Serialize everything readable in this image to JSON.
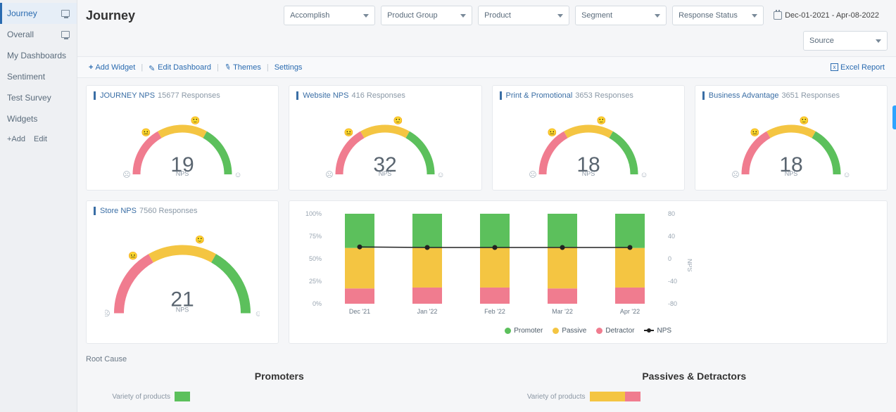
{
  "sidebar": {
    "items": [
      {
        "label": "Journey",
        "active": true,
        "hasMonitor": true
      },
      {
        "label": "Overall",
        "active": false,
        "hasMonitor": true
      },
      {
        "label": "My Dashboards",
        "active": false,
        "hasMonitor": false
      },
      {
        "label": "Sentiment",
        "active": false,
        "hasMonitor": false
      },
      {
        "label": "Test Survey",
        "active": false,
        "hasMonitor": false
      },
      {
        "label": "Widgets",
        "active": false,
        "hasMonitor": false
      }
    ],
    "add": "+Add",
    "edit": "Edit"
  },
  "header": {
    "title": "Journey",
    "filters": [
      {
        "label": "Accomplish"
      },
      {
        "label": "Product Group"
      },
      {
        "label": "Product"
      },
      {
        "label": "Segment"
      },
      {
        "label": "Response Status"
      }
    ],
    "date_range": "Dec-01-2021 - Apr-08-2022",
    "source_filter": "Source"
  },
  "toolbar": {
    "add_widget": "Add Widget",
    "edit_dashboard": "Edit Dashboard",
    "themes": "Themes",
    "settings": "Settings",
    "excel_report": "Excel Report"
  },
  "gauges": [
    {
      "title": "JOURNEY NPS",
      "sub": "15677 Responses",
      "value": 19,
      "label": "NPS"
    },
    {
      "title": "Website NPS",
      "sub": "416 Responses",
      "value": 32,
      "label": "NPS"
    },
    {
      "title": "Print & Promotional",
      "sub": "3653 Responses",
      "value": 18,
      "label": "NPS"
    },
    {
      "title": "Business Advantage",
      "sub": "3651 Responses",
      "value": 18,
      "label": "NPS"
    },
    {
      "title": "Store NPS",
      "sub": "7560 Responses",
      "value": 21,
      "label": "NPS"
    }
  ],
  "colors": {
    "red": "#f07c8f",
    "yellow": "#f4c542",
    "green": "#5cc05c",
    "nps_line": "#222222"
  },
  "chart_data": {
    "type": "bar",
    "title": "",
    "ylabel_left": "%",
    "ylabel_right": "NPS",
    "ylim_left": [
      0,
      100
    ],
    "ylim_right": [
      -80,
      80
    ],
    "y_ticks_left": [
      "0%",
      "25%",
      "50%",
      "75%",
      "100%"
    ],
    "y_ticks_right": [
      "-80",
      "-40",
      "0",
      "40",
      "80"
    ],
    "categories": [
      "Dec '21",
      "Jan '22",
      "Feb '22",
      "Mar '22",
      "Apr '22"
    ],
    "series": [
      {
        "name": "Promoter",
        "color": "#5cc05c",
        "values": [
          38,
          38,
          38,
          37,
          38
        ]
      },
      {
        "name": "Passive",
        "color": "#f4c542",
        "values": [
          45,
          44,
          44,
          46,
          44
        ]
      },
      {
        "name": "Detractor",
        "color": "#f07c8f",
        "values": [
          17,
          18,
          18,
          17,
          18
        ]
      }
    ],
    "line": {
      "name": "NPS",
      "color": "#222222",
      "values": [
        21,
        20,
        20,
        20,
        20
      ]
    }
  },
  "root_cause": {
    "title": "Root Cause",
    "col1": {
      "heading": "Promoters",
      "rows": [
        {
          "label": "Variety of products",
          "promoter": 100
        }
      ]
    },
    "col2": {
      "heading": "Passives & Detractors",
      "rows": [
        {
          "label": "Variety of products",
          "passive": 70,
          "detractor": 30
        }
      ]
    }
  }
}
